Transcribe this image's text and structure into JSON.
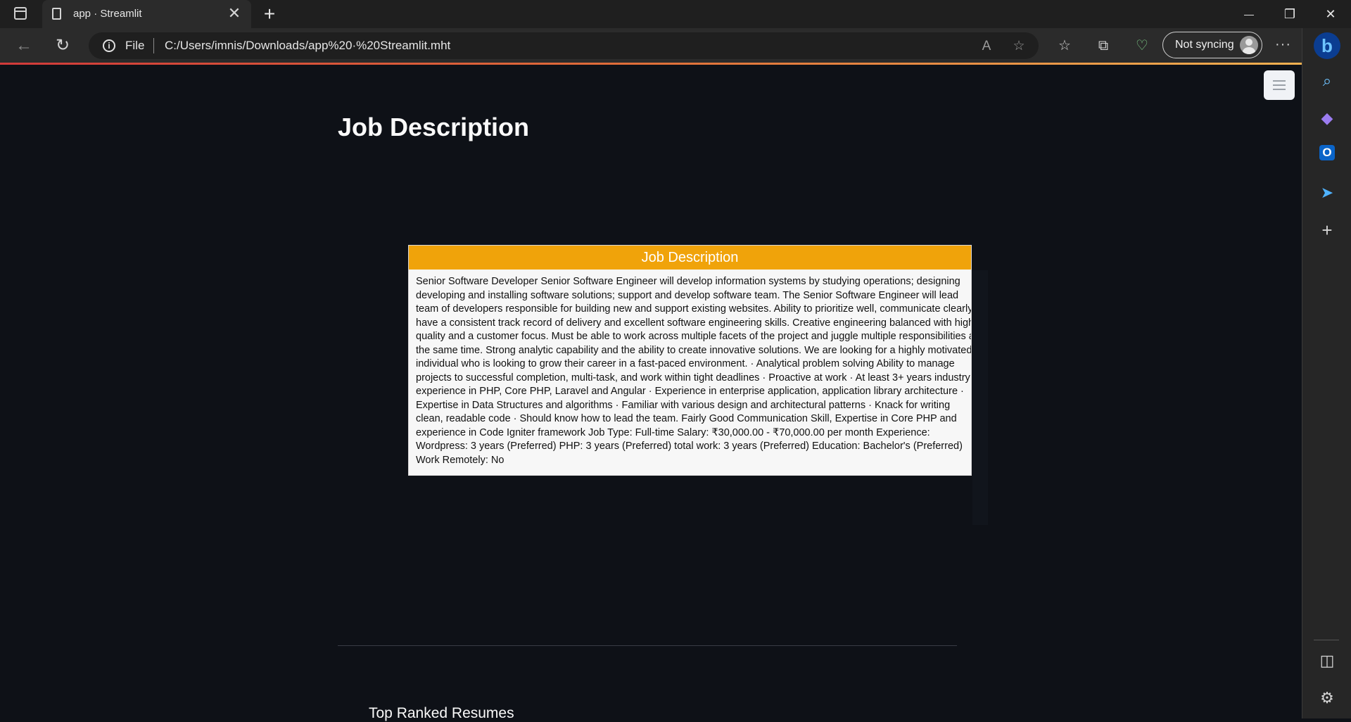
{
  "browser": {
    "tab_title": "app · Streamlit",
    "address_scheme": "File",
    "address_url": "C:/Users/imnis/Downloads/app%20·%20Streamlit.mht",
    "profile_label": "Not syncing"
  },
  "page": {
    "title": "Job Description",
    "card_header": "Job Description",
    "job_text": "Senior Software Developer  Senior Software Engineer will develop information systems by studying operations; designing developing and installing software solutions; support and develop software team. The Senior Software Engineer will lead team of developers responsible for building new and support existing websites.  Ability to prioritize well, communicate clearly, have a consistent track record of delivery and excellent software engineering skills. Creative engineering balanced with high quality and a customer focus. Must be able to work across multiple facets of the project and juggle multiple responsibilities at the same time. Strong analytic capability and the ability to create innovative solutions. We are looking for a highly motivated individual who is looking to grow their career in a fast-paced environment.  · Analytical problem solving  Ability to manage projects to successful completion, multi-task, and work within tight deadlines  · Proactive at work  · At least 3+ years industry experience in PHP, Core PHP, Laravel and Angular  · Experience in enterprise application, application library architecture  · Expertise in Data Structures and algorithms  · Familiar with various design and architectural patterns  · Knack for writing clean, readable code  · Should know how to lead the team. Fairly Good Communication Skill, Expertise in Core PHP and experience in Code Igniter framework  Job Type: Full-time  Salary: ₹30,000.00 - ₹70,000.00 per month  Experience:  Wordpress: 3 years (Preferred)  PHP: 3 years (Preferred)  total work: 3 years (Preferred)  Education:  Bachelor's (Preferred)  Work Remotely:  No",
    "section_title": "Top Ranked Resumes"
  },
  "icons": {
    "close": "✕",
    "new_tab": "+",
    "minimize": "—",
    "restore": "❐",
    "back": "←",
    "refresh": "↻",
    "info": "i",
    "read_aloud": "A",
    "add_favorite": "☆",
    "favorites": "☆",
    "collections": "⧉",
    "performance": "♡",
    "more": "···",
    "bing": "b",
    "search": "⌕",
    "copilot": "◆",
    "outlook": "O",
    "send": "➤",
    "add": "+",
    "split": "◫",
    "settings": "⚙"
  },
  "colors": {
    "accent_header": "#f0a30a",
    "page_bg": "#0e1117"
  }
}
